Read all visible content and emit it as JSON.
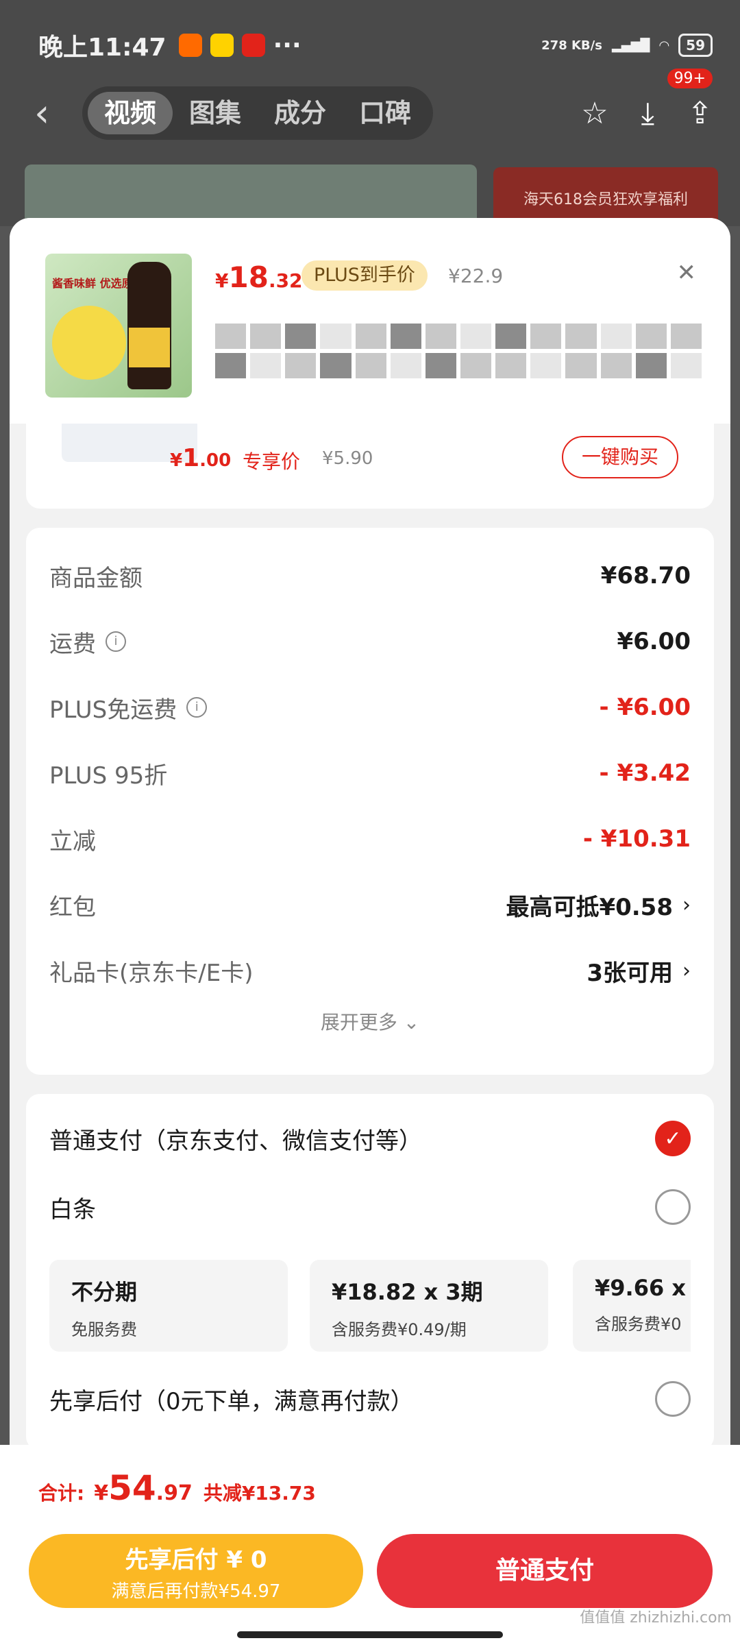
{
  "status": {
    "time": "晚上11:47",
    "net_speed": "278 KB/s",
    "battery": "59"
  },
  "nav": {
    "tabs": [
      "视频",
      "图集",
      "成分",
      "口碑"
    ],
    "badge": "99+"
  },
  "banner": {
    "text": "海天618会员狂欢享福利"
  },
  "product": {
    "thumb_brand": "酱香味鲜 优选原料",
    "price": {
      "cur": "¥",
      "int": "18",
      "dec": ".32"
    },
    "plus_tag": "PLUS到手价",
    "orig": "¥22.9"
  },
  "upsell": {
    "price": {
      "cur": "¥",
      "int": "1",
      "dec": ".00"
    },
    "tag": "专享价",
    "orig": "¥5.90",
    "buy": "一键购买"
  },
  "summary": {
    "rows": [
      {
        "label": "商品金额",
        "value": "¥68.70"
      },
      {
        "label": "运费",
        "value": "¥6.00"
      },
      {
        "label": "PLUS免运费",
        "value": "- ¥6.00"
      },
      {
        "label": "PLUS 95折",
        "value": "- ¥3.42"
      },
      {
        "label": "立减",
        "value": "- ¥10.31"
      },
      {
        "label": "红包",
        "value": "最高可抵¥0.58"
      },
      {
        "label": "礼品卡(京东卡/E卡)",
        "value": "3张可用"
      }
    ],
    "expand": "展开更多 ⌄"
  },
  "payment": {
    "options": [
      {
        "label": "普通支付（京东支付、微信支付等）"
      },
      {
        "label": "白条"
      },
      {
        "label": "先享后付（0元下单，满意再付款）"
      }
    ],
    "plans": [
      {
        "title": "不分期",
        "sub": "免服务费"
      },
      {
        "title": "¥18.82 x 3期",
        "sub": "含服务费¥0.49/期"
      },
      {
        "title": "¥9.66 x",
        "sub": "含服务费¥0"
      }
    ]
  },
  "footer": {
    "total_label": "合计:",
    "total": {
      "cur": "¥",
      "int": "54",
      "dec": ".97"
    },
    "saved": "共减¥13.73",
    "later_btn": "先享后付 ¥ 0",
    "later_sub": "满意后再付款¥54.97",
    "normal_btn": "普通支付"
  },
  "watermark": "值值值 zhizhizhi.com"
}
